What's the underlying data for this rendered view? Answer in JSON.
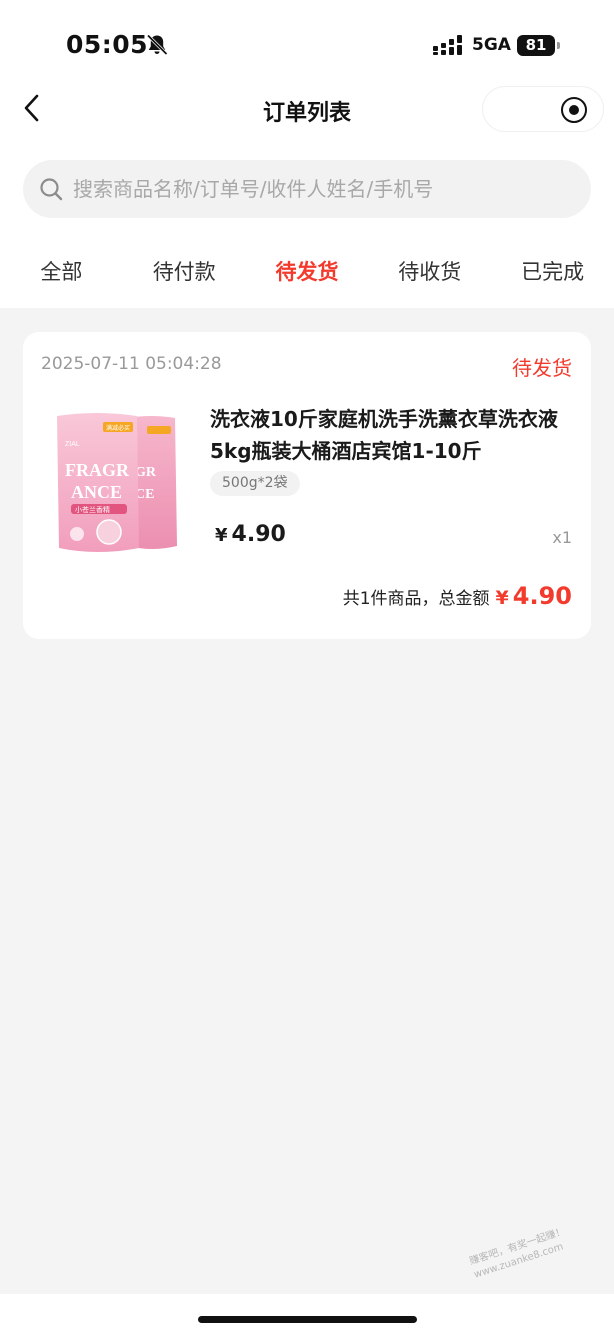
{
  "status_bar": {
    "time": "05:05",
    "network": "5GA",
    "battery": "81",
    "icons": [
      "bell-mute-icon",
      "signal-icon",
      "battery-icon"
    ]
  },
  "nav": {
    "back_icon": "chevron-left-icon",
    "title": "订单列表",
    "capsule_icon": "target-icon"
  },
  "search": {
    "placeholder": "搜索商品名称/订单号/收件人姓名/手机号",
    "icon": "search-icon"
  },
  "tabs": [
    {
      "label": "全部",
      "active": false
    },
    {
      "label": "待付款",
      "active": false
    },
    {
      "label": "待发货",
      "active": true
    },
    {
      "label": "待收货",
      "active": false
    },
    {
      "label": "已完成",
      "active": false
    }
  ],
  "order": {
    "time": "2025-07-11 05:04:28",
    "status": "待发货",
    "product": {
      "title": "洗衣液10斤家庭机洗手洗薰衣草洗衣液5kg瓶装大桶酒店宾馆1-10斤",
      "sku": "500g*2袋",
      "price_symbol": "¥",
      "price": "4.90",
      "quantity": "x1",
      "image_text": {
        "brand": "ZIAL",
        "line1": "FRAGR",
        "line2": "ANCE",
        "badge": "满减必买",
        "subtitle": "小苍兰香精"
      }
    },
    "total_label": "共1件商品，总金额",
    "total_symbol": "¥",
    "total_amount": "4.90"
  },
  "watermark": {
    "line1": "赚客吧，有奖一起赚！",
    "line2": "www.zuanke8.com"
  },
  "colors": {
    "accent": "#f23b2d",
    "background": "#f4f4f4",
    "card": "#ffffff"
  }
}
